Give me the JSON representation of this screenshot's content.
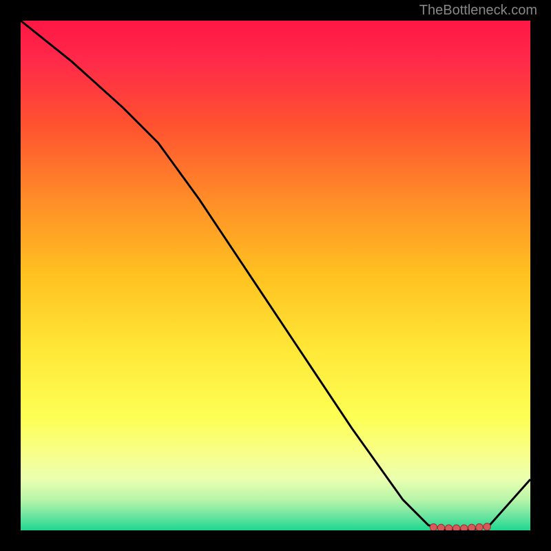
{
  "watermark": "TheBottleneck.com",
  "chart_data": {
    "type": "line",
    "title": "",
    "xlabel": "",
    "ylabel": "",
    "xlim": [
      0,
      100
    ],
    "ylim": [
      0,
      100
    ],
    "curve": {
      "x": [
        0,
        10,
        20,
        27,
        35,
        45,
        55,
        65,
        75,
        80,
        84,
        88,
        92,
        100
      ],
      "y": [
        100,
        92,
        83,
        76,
        65,
        50,
        35,
        20,
        6,
        1,
        0,
        0,
        1,
        10
      ]
    },
    "markers": {
      "x": [
        81,
        82.5,
        84,
        85.5,
        87,
        88.5,
        90,
        91.5
      ],
      "y": [
        0.6,
        0.5,
        0.4,
        0.4,
        0.4,
        0.5,
        0.6,
        0.7
      ]
    },
    "gradient_stops": [
      {
        "offset": 0,
        "color": "#ff1744"
      },
      {
        "offset": 0.08,
        "color": "#ff2a4a"
      },
      {
        "offset": 0.2,
        "color": "#ff5030"
      },
      {
        "offset": 0.35,
        "color": "#ff8c28"
      },
      {
        "offset": 0.5,
        "color": "#ffc220"
      },
      {
        "offset": 0.65,
        "color": "#ffe838"
      },
      {
        "offset": 0.78,
        "color": "#fdff55"
      },
      {
        "offset": 0.85,
        "color": "#f8ff8a"
      },
      {
        "offset": 0.9,
        "color": "#eaffb0"
      },
      {
        "offset": 0.94,
        "color": "#b8f5a8"
      },
      {
        "offset": 0.97,
        "color": "#70e5a0"
      },
      {
        "offset": 1.0,
        "color": "#1ed890"
      }
    ]
  }
}
